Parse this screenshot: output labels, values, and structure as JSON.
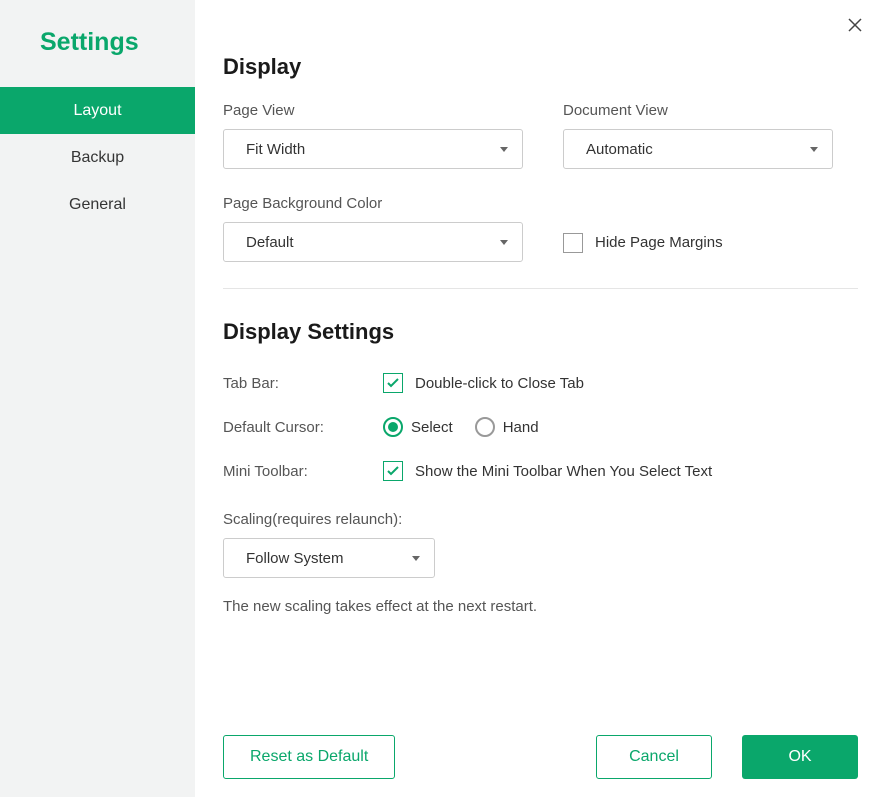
{
  "sidebar": {
    "title": "Settings",
    "items": [
      {
        "label": "Layout",
        "active": true
      },
      {
        "label": "Backup",
        "active": false
      },
      {
        "label": "General",
        "active": false
      }
    ]
  },
  "display": {
    "heading": "Display",
    "page_view": {
      "label": "Page View",
      "value": "Fit Width"
    },
    "document_view": {
      "label": "Document View",
      "value": "Automatic"
    },
    "bg_color": {
      "label": "Page Background Color",
      "value": "Default"
    },
    "hide_margins": {
      "label": "Hide Page Margins",
      "checked": false
    }
  },
  "display_settings": {
    "heading": "Display Settings",
    "tab_bar": {
      "label": "Tab Bar:",
      "option": "Double-click to Close Tab",
      "checked": true
    },
    "default_cursor": {
      "label": "Default Cursor:",
      "options": [
        "Select",
        "Hand"
      ],
      "selected": "Select"
    },
    "mini_toolbar": {
      "label": "Mini Toolbar:",
      "option": "Show the Mini Toolbar When You Select Text",
      "checked": true
    },
    "scaling": {
      "label": "Scaling(requires relaunch):",
      "value": "Follow System"
    },
    "scaling_note": "The new scaling takes effect at the next restart."
  },
  "footer": {
    "reset": "Reset as Default",
    "cancel": "Cancel",
    "ok": "OK"
  }
}
